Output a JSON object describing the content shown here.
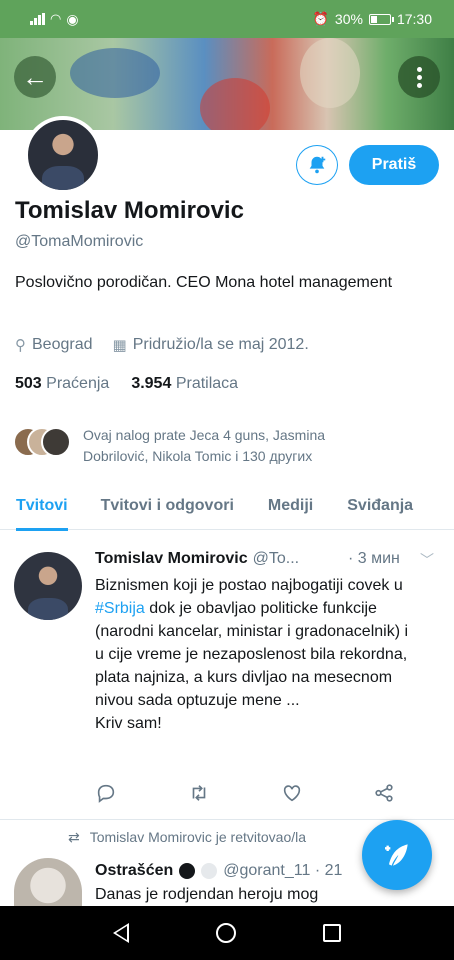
{
  "status_bar": {
    "battery": "30%",
    "battery_level": 0.3,
    "time": "17:30"
  },
  "profile": {
    "name": "Tomislav Momirovic",
    "handle": "@TomaMomirovic",
    "bio": "Poslovično porodičan. CEO Mona hotel management",
    "location": "Beograd",
    "joined": "Pridružio/la se maj 2012.",
    "following_count": "503",
    "following_label": "Praćenja",
    "followers_count": "3.954",
    "followers_label": "Pratilaca",
    "followed_by": "Ovaj nalog prate Jeca 4 guns, Jasmina Dobrilović, Nikola Tomic i 130 других",
    "follow_button": "Pratiš"
  },
  "tabs": [
    {
      "label": "Tvitovi",
      "active": true
    },
    {
      "label": "Tvitovi i odgovori",
      "active": false
    },
    {
      "label": "Mediji",
      "active": false
    },
    {
      "label": "Sviđanja",
      "active": false
    }
  ],
  "tweet": {
    "name": "Tomislav Momirovic",
    "handle": "@To...",
    "time": "· 3 мин",
    "text_before": "Biznismen koji je postao najbogatiji covek u ",
    "hashtag": "#Srbija",
    "text_after": " dok je obavljao politicke funkcije (narodni kancelar, ministar i gradonacelnik) i u cije vreme je nezaposlenost bila rekordna, plata najniza, a kurs divljao na mesecnom nivou sada optuzuje mene ...",
    "text_last": "Kriv sam!"
  },
  "retweet": {
    "context": "Tomislav Momirovic je retvitovao/la",
    "name": "Ostrašćen",
    "handle": "@gorant_11 · 21",
    "text": "Danas je rodjendan heroju mog"
  },
  "colors": {
    "accent": "#1da1f2",
    "statusbar": "#5fa35b"
  }
}
